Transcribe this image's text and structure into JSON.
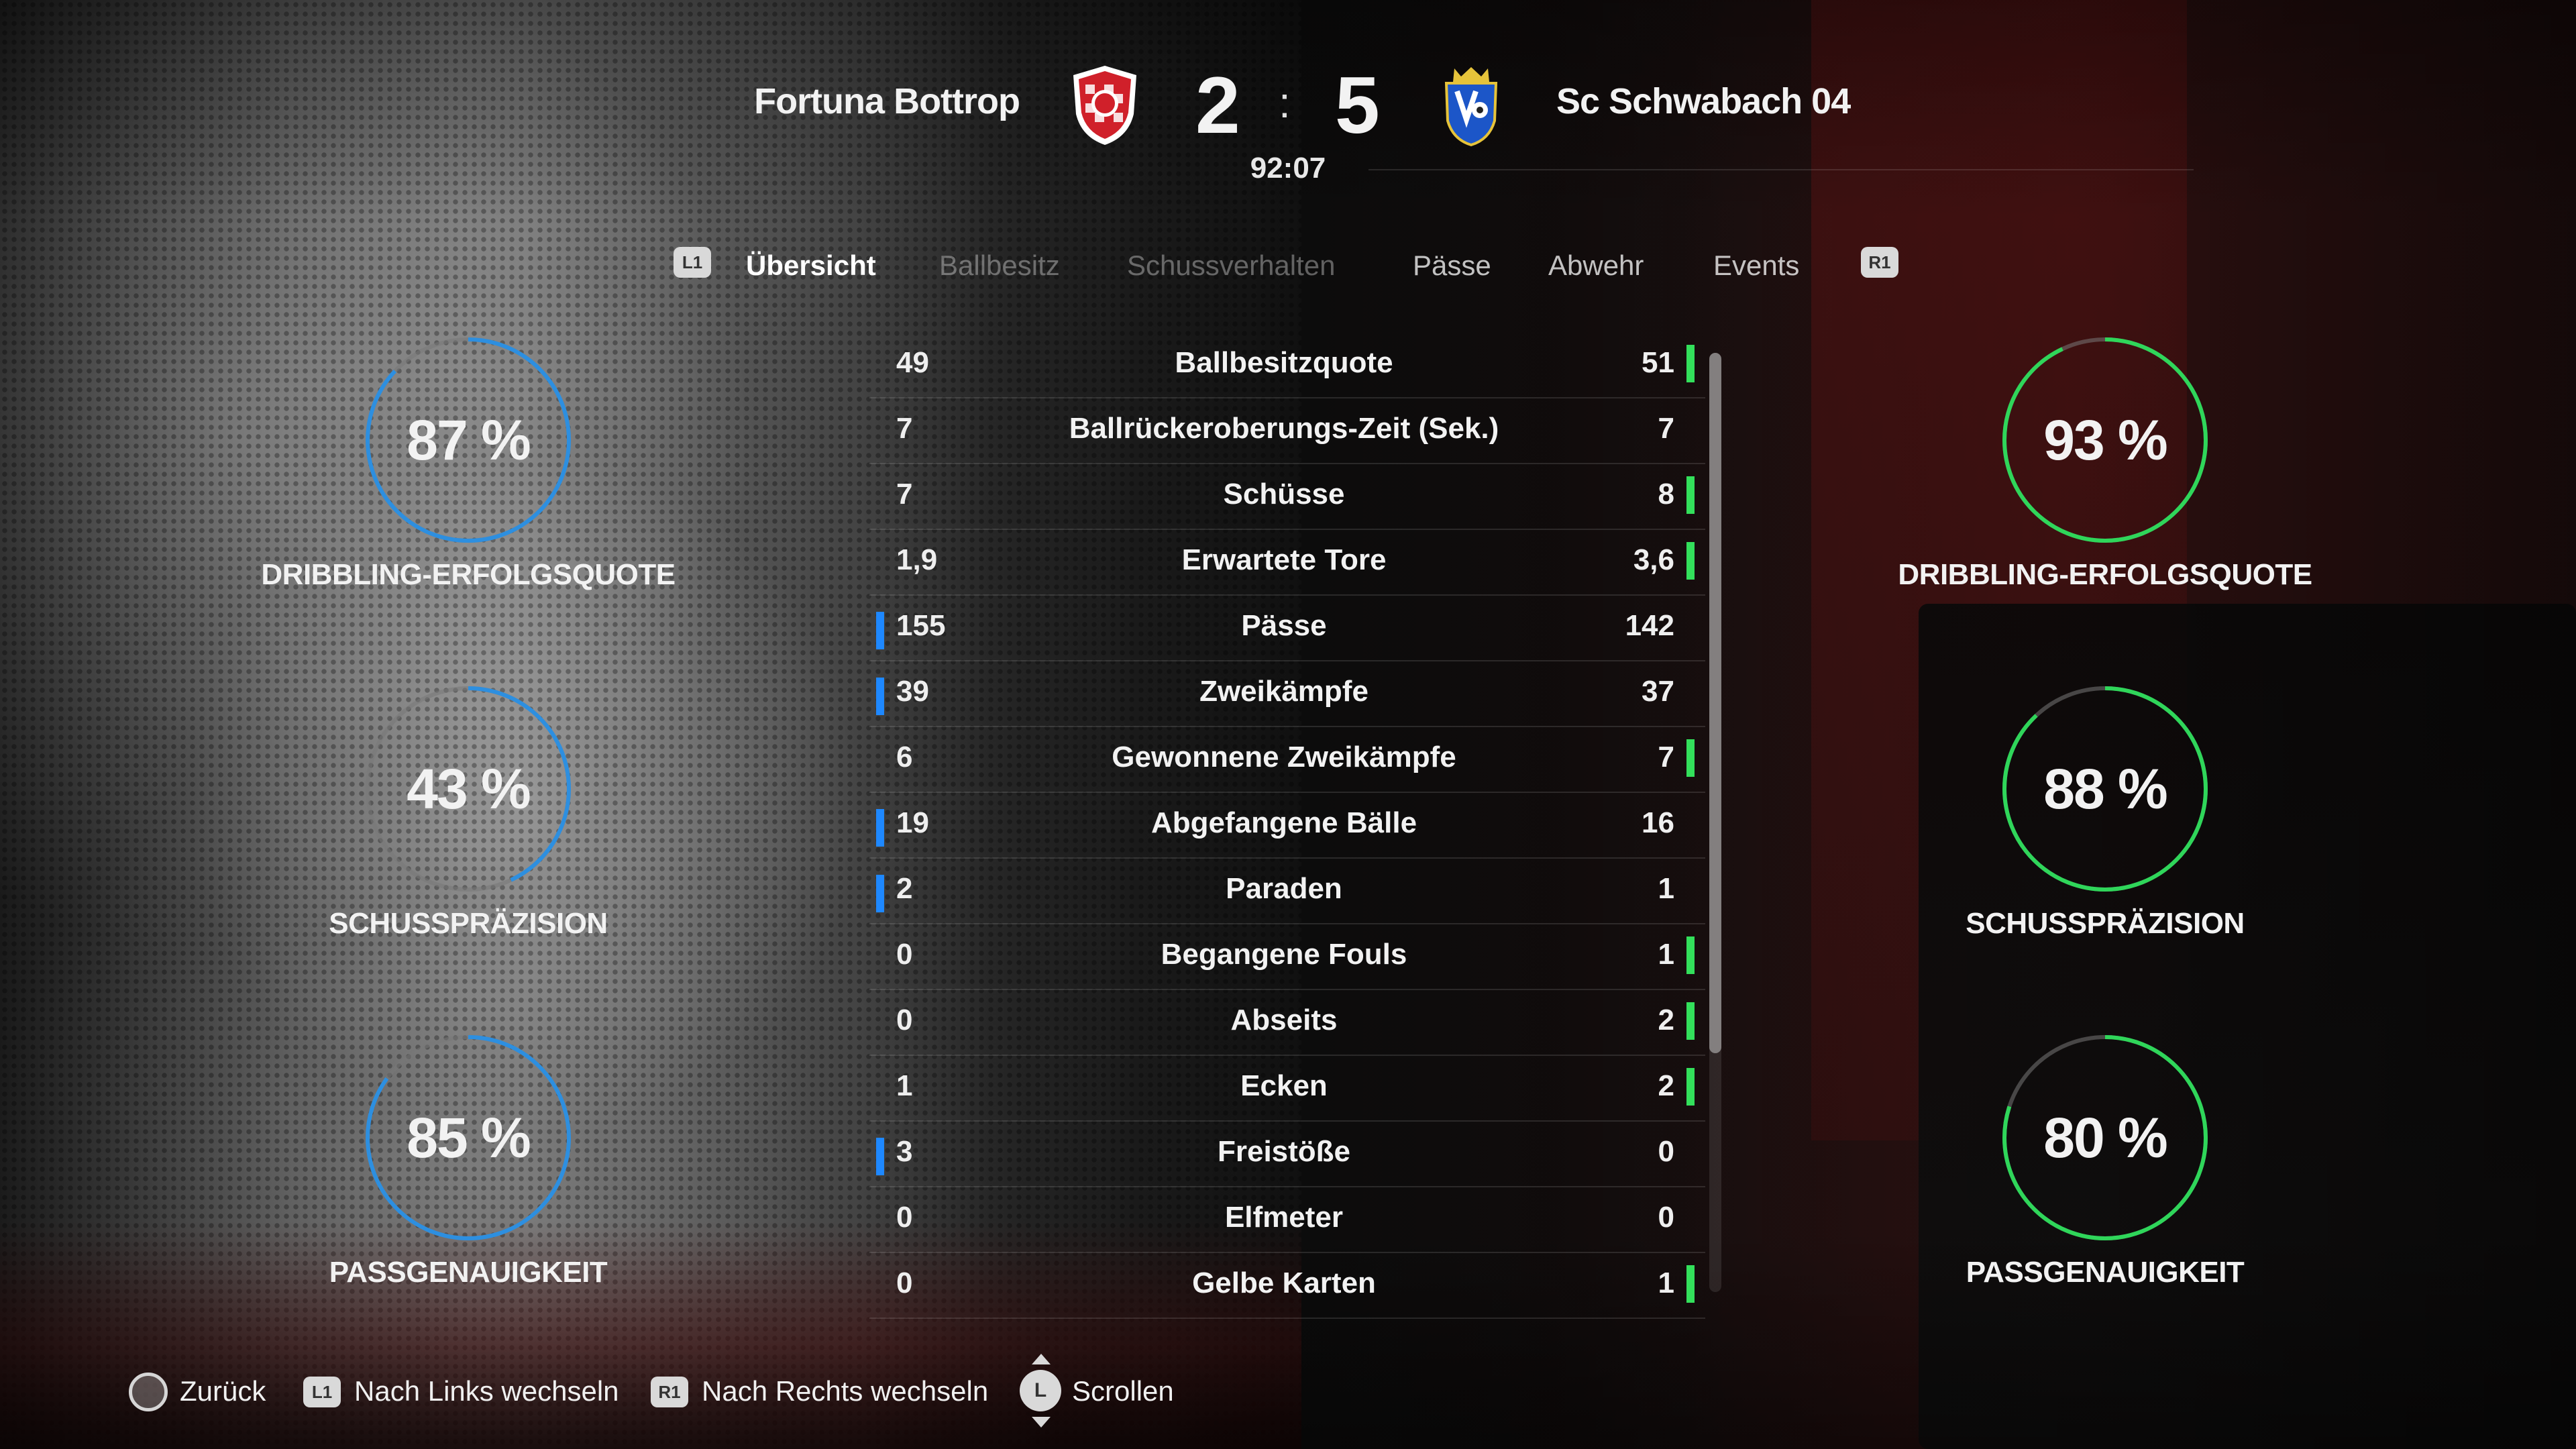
{
  "match": {
    "home_team": "Fortuna Bottrop",
    "away_team": "Sc Schwabach 04",
    "home_score": "2",
    "away_score": "5",
    "score_separator": ":",
    "clock": "92:07"
  },
  "tabs": {
    "left_button": "L1",
    "right_button": "R1",
    "items": [
      "Übersicht",
      "Ballbesitz",
      "Schussverhalten",
      "Pässe",
      "Abwehr",
      "Events"
    ],
    "active": "Übersicht"
  },
  "home_rings": [
    {
      "value_text": "87 %",
      "label": "DRIBBLING-ERFOLGSQUOTE",
      "percent": 87,
      "color": "#2d8fe0"
    },
    {
      "value_text": "43 %",
      "label": "SCHUSSPRÄZISION",
      "percent": 43,
      "color": "#2d8fe0"
    },
    {
      "value_text": "85 %",
      "label": "PASSGENAUIGKEIT",
      "percent": 85,
      "color": "#2d8fe0"
    }
  ],
  "away_rings": [
    {
      "value_text": "93 %",
      "label": "DRIBBLING-ERFOLGSQUOTE",
      "percent": 93,
      "color": "#2fd65a"
    },
    {
      "value_text": "88 %",
      "label": "SCHUSSPRÄZISION",
      "percent": 88,
      "color": "#2fd65a"
    },
    {
      "value_text": "80 %",
      "label": "PASSGENAUIGKEIT",
      "percent": 80,
      "color": "#2fd65a"
    }
  ],
  "stats": [
    {
      "label": "Ballbesitzquote",
      "home": "49",
      "away": "51",
      "leader": "away"
    },
    {
      "label": "Ballrückeroberungs-Zeit (Sek.)",
      "home": "7",
      "away": "7",
      "leader": "none"
    },
    {
      "label": "Schüsse",
      "home": "7",
      "away": "8",
      "leader": "away"
    },
    {
      "label": "Erwartete Tore",
      "home": "1,9",
      "away": "3,6",
      "leader": "away"
    },
    {
      "label": "Pässe",
      "home": "155",
      "away": "142",
      "leader": "home"
    },
    {
      "label": "Zweikämpfe",
      "home": "39",
      "away": "37",
      "leader": "home"
    },
    {
      "label": "Gewonnene Zweikämpfe",
      "home": "6",
      "away": "7",
      "leader": "away"
    },
    {
      "label": "Abgefangene Bälle",
      "home": "19",
      "away": "16",
      "leader": "home"
    },
    {
      "label": "Paraden",
      "home": "2",
      "away": "1",
      "leader": "home"
    },
    {
      "label": "Begangene Fouls",
      "home": "0",
      "away": "1",
      "leader": "away"
    },
    {
      "label": "Abseits",
      "home": "0",
      "away": "2",
      "leader": "away"
    },
    {
      "label": "Ecken",
      "home": "1",
      "away": "2",
      "leader": "away"
    },
    {
      "label": "Freistöße",
      "home": "3",
      "away": "0",
      "leader": "home"
    },
    {
      "label": "Elfmeter",
      "home": "0",
      "away": "0",
      "leader": "none"
    },
    {
      "label": "Gelbe Karten",
      "home": "0",
      "away": "1",
      "leader": "away"
    }
  ],
  "colors": {
    "home_accent": "#1e88ff",
    "away_accent": "#33e05b"
  },
  "footer": {
    "back": "Zurück",
    "left_badge": "L1",
    "left": "Nach Links wechseln",
    "right_badge": "R1",
    "right": "Nach Rechts wechseln",
    "stick": "L",
    "scroll": "Scrollen"
  }
}
